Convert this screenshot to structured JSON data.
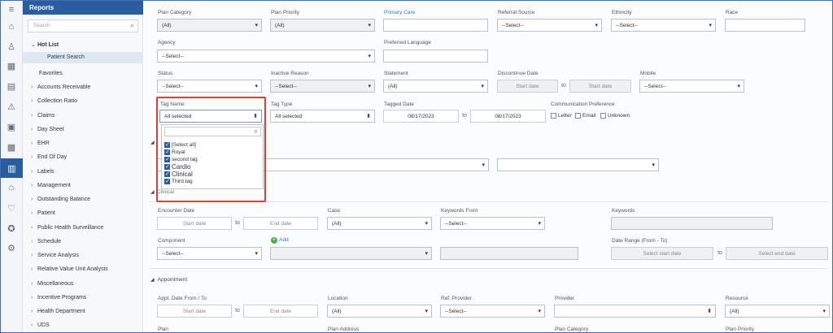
{
  "sidebar": {
    "title": "Reports",
    "search_placeholder": "Search",
    "items": [
      {
        "label": "Hot List",
        "expanded": true
      },
      {
        "label": "Patient Search",
        "sub": true
      },
      {
        "label": "Favorites"
      },
      {
        "label": "Accounts Receivable"
      },
      {
        "label": "Collection Ratio"
      },
      {
        "label": "Claims"
      },
      {
        "label": "Day Sheet"
      },
      {
        "label": "EHR"
      },
      {
        "label": "End Of Day"
      },
      {
        "label": "Labels"
      },
      {
        "label": "Management"
      },
      {
        "label": "Outstanding Balance"
      },
      {
        "label": "Patient"
      },
      {
        "label": "Public Health Surveillance"
      },
      {
        "label": "Schedule"
      },
      {
        "label": "Service Analysis"
      },
      {
        "label": "Relative Value Unit Analysis"
      },
      {
        "label": "Miscellaneous"
      },
      {
        "label": "Incentive Programs"
      },
      {
        "label": "Health Department"
      },
      {
        "label": "UDS"
      }
    ]
  },
  "form": {
    "plan_category_label": "Plan Category",
    "plan_category_value": "(All)",
    "plan_priority_label": "Plan Priority",
    "plan_priority_value": "(All)",
    "primary_care_label": "Primary Care",
    "referral_source_label": "Referral Source",
    "referral_source_value": "--Select--",
    "ethnicity_label": "Ethnicity",
    "ethnicity_value": "--Select--",
    "race_label": "Race",
    "agency_label": "Agency",
    "agency_value": "--Select--",
    "preferred_language_label": "Preferred Language",
    "status_label": "Status",
    "status_value": "--Select--",
    "inactive_reason_label": "Inactive Reason",
    "inactive_reason_value": "--Select--",
    "statement_label": "Statement",
    "statement_value": "(All)",
    "discontinue_date_label": "Discontinue Date",
    "start_date_ph": "Start date",
    "to": "to",
    "mobile_label": "Mobile",
    "mobile_value": "--Select--",
    "tag_name_label": "Tag Name",
    "tag_name_value": "All selected",
    "tag_type_label": "Tag Type",
    "tag_type_value": "All selected",
    "tagged_date_label": "Tagged Date",
    "tagged_from": "08/17/2023",
    "tagged_to": "08/17/2023",
    "comm_pref_label": "Communication Preference",
    "comm_letter": "Letter",
    "comm_email": "Email",
    "comm_unknown": "Unknown",
    "clinical_section": "Clinical",
    "encounter_date_label": "Encounter Date",
    "end_date_ph": "End date",
    "case_label": "Case",
    "case_value": "(All)",
    "keywords_from_label": "Keywords From",
    "keywords_from_value": "--Select--",
    "keywords_label": "Keywords",
    "component_label": "Component",
    "component_value": "--Select--",
    "add_label": "Add",
    "date_range_label": "Date Range (From - To)",
    "select_start_date": "Select start date",
    "select_end_date": "Select end date",
    "appointment_section": "Appointment",
    "appt_date_label": "Appt. Date From / To",
    "location_label": "Location",
    "location_value": "(All)",
    "ref_provider_label": "Ref. Provider",
    "ref_provider_value": "--Select--",
    "provider_label": "Provider",
    "resource_label": "Resource",
    "resource_value": "(All)",
    "plan_label": "Plan",
    "plan_address_label": "Plan Address",
    "plan_category2_label": "Plan Category",
    "plan_priority2_label": "Plan Priority"
  },
  "tag_dropdown": {
    "options": [
      {
        "label": "[Select all]",
        "checked": true
      },
      {
        "label": "Royal",
        "checked": true
      },
      {
        "label": "second tag",
        "checked": true
      },
      {
        "label": "Cardio",
        "checked": true
      },
      {
        "label": "Clinical",
        "checked": true
      },
      {
        "label": "Third tag",
        "checked": true
      }
    ]
  },
  "colors": {
    "accent": "#2a5d9f",
    "highlight": "#e53935"
  }
}
